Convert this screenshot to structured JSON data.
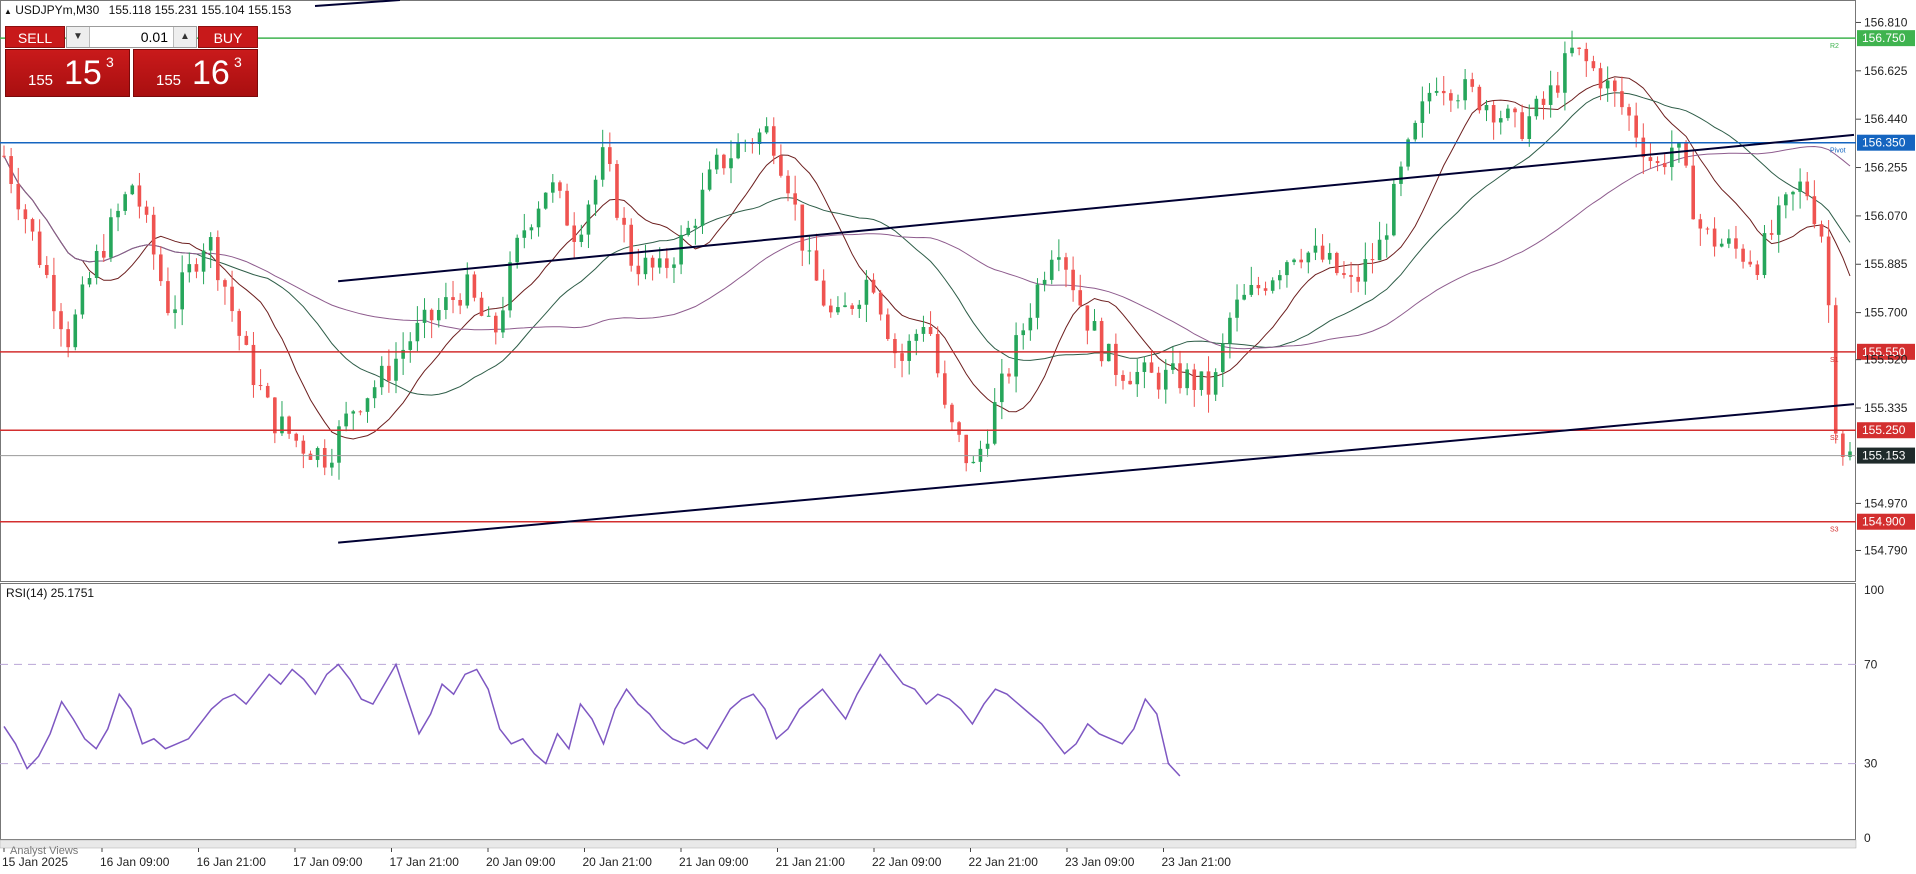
{
  "header": {
    "symbol_timeframe": "USDJPYm,M30",
    "ohlc": "155.118 155.231 155.104 155.153"
  },
  "trade_panel": {
    "sell_label": "SELL",
    "buy_label": "BUY",
    "lot_value": "0.01",
    "bid": {
      "base": "155",
      "big": "15",
      "sup": "3"
    },
    "ask": {
      "base": "155",
      "big": "16",
      "sup": "3"
    }
  },
  "rsi_title": "RSI(14) 25.1751",
  "footer_tab": "Analyst Views",
  "colors": {
    "bull": "#26a65b",
    "bear": "#ef5350",
    "pivot": "#1565c0",
    "resistance": "#3fb34f",
    "support": "#d32f2f",
    "trendline": "#000033",
    "rsi": "#7e57c2",
    "ma_fast": "#6d1f1f",
    "ma_mid": "#2e5d48",
    "ma_slow": "#8e5c8e"
  },
  "chart_data": [
    {
      "type": "candlestick",
      "title": "USDJPYm,M30",
      "ylim": [
        154.7,
        156.85
      ],
      "y_ticks": [
        "156.810",
        "156.625",
        "156.440",
        "156.255",
        "156.070",
        "155.885",
        "155.700",
        "155.520",
        "155.335",
        "154.970",
        "154.790"
      ],
      "x_ticks": [
        "15 Jan 2025",
        "16 Jan 09:00",
        "16 Jan 21:00",
        "17 Jan 09:00",
        "17 Jan 21:00",
        "20 Jan 09:00",
        "20 Jan 21:00",
        "21 Jan 09:00",
        "21 Jan 21:00",
        "22 Jan 09:00",
        "22 Jan 21:00",
        "23 Jan 09:00",
        "23 Jan 21:00"
      ],
      "levels": [
        {
          "name": "R2",
          "value": 156.75,
          "label": "156.750",
          "role": "resistance"
        },
        {
          "name": "Pivot",
          "value": 156.35,
          "label": "156.350",
          "role": "pivot"
        },
        {
          "name": "S1",
          "value": 155.55,
          "label": "155.550",
          "role": "support"
        },
        {
          "name": "S2",
          "value": 155.25,
          "label": "155.250",
          "role": "support"
        },
        {
          "name": "S3",
          "value": 154.9,
          "label": "154.900",
          "role": "support"
        }
      ],
      "current_price": {
        "value": 155.153,
        "label": "155.153"
      },
      "close_path": [
        [
          0,
          156.3
        ],
        [
          0.02,
          155.9
        ],
        [
          0.035,
          155.6
        ],
        [
          0.05,
          155.9
        ],
        [
          0.07,
          156.2
        ],
        [
          0.09,
          155.7
        ],
        [
          0.11,
          156.0
        ],
        [
          0.12,
          155.8
        ],
        [
          0.13,
          155.55
        ],
        [
          0.145,
          155.3
        ],
        [
          0.16,
          155.2
        ],
        [
          0.175,
          155.15
        ],
        [
          0.19,
          155.35
        ],
        [
          0.205,
          155.45
        ],
        [
          0.22,
          155.6
        ],
        [
          0.235,
          155.7
        ],
        [
          0.25,
          155.8
        ],
        [
          0.265,
          155.6
        ],
        [
          0.28,
          156.0
        ],
        [
          0.295,
          156.2
        ],
        [
          0.31,
          156.0
        ],
        [
          0.325,
          156.3
        ],
        [
          0.34,
          155.9
        ],
        [
          0.355,
          155.85
        ],
        [
          0.37,
          156.0
        ],
        [
          0.385,
          156.25
        ],
        [
          0.4,
          156.35
        ],
        [
          0.415,
          156.4
        ],
        [
          0.425,
          156.2
        ],
        [
          0.435,
          155.9
        ],
        [
          0.45,
          155.65
        ],
        [
          0.47,
          155.85
        ],
        [
          0.485,
          155.5
        ],
        [
          0.5,
          155.7
        ],
        [
          0.51,
          155.3
        ],
        [
          0.525,
          155.1
        ],
        [
          0.54,
          155.4
        ],
        [
          0.555,
          155.7
        ],
        [
          0.57,
          156.0
        ],
        [
          0.585,
          155.7
        ],
        [
          0.6,
          155.5
        ],
        [
          0.62,
          155.45
        ],
        [
          0.64,
          155.45
        ],
        [
          0.655,
          155.4
        ],
        [
          0.665,
          155.7
        ],
        [
          0.68,
          155.8
        ],
        [
          0.7,
          155.95
        ],
        [
          0.715,
          155.9
        ],
        [
          0.73,
          155.8
        ],
        [
          0.745,
          155.95
        ],
        [
          0.76,
          156.3
        ],
        [
          0.775,
          156.6
        ],
        [
          0.79,
          156.55
        ],
        [
          0.805,
          156.5
        ],
        [
          0.82,
          156.4
        ],
        [
          0.835,
          156.5
        ],
        [
          0.85,
          156.7
        ],
        [
          0.865,
          156.6
        ],
        [
          0.88,
          156.45
        ],
        [
          0.895,
          156.25
        ],
        [
          0.905,
          156.35
        ],
        [
          0.92,
          156.0
        ],
        [
          0.935,
          155.95
        ],
        [
          0.95,
          155.9
        ],
        [
          0.965,
          156.1
        ],
        [
          0.975,
          156.2
        ],
        [
          0.985,
          156.0
        ],
        [
          0.99,
          155.6
        ],
        [
          0.993,
          155.2
        ],
        [
          1.0,
          155.15
        ]
      ],
      "trendlines": [
        {
          "from": [
            0.181,
            155.82
          ],
          "to": [
            1.0,
            156.38
          ]
        },
        {
          "from": [
            0.181,
            154.82
          ],
          "to": [
            1.0,
            155.35
          ]
        }
      ]
    },
    {
      "type": "line",
      "title": "RSI(14) 25.1751",
      "ylim": [
        0,
        100
      ],
      "y_ticks": [
        "100",
        "70",
        "30",
        "0"
      ],
      "levels": [
        70,
        30
      ],
      "series": [
        {
          "values": [
            45,
            38,
            28,
            33,
            42,
            55,
            48,
            40,
            36,
            44,
            58,
            52,
            38,
            40,
            36,
            38,
            40,
            46,
            52,
            56,
            58,
            54,
            60,
            66,
            62,
            68,
            64,
            58,
            66,
            70,
            64,
            56,
            54,
            62,
            70,
            56,
            42,
            50,
            62,
            58,
            66,
            68,
            60,
            44,
            38,
            40,
            34,
            30,
            42,
            36,
            54,
            48,
            38,
            52,
            60,
            54,
            50,
            44,
            40,
            38,
            40,
            36,
            44,
            52,
            56,
            58,
            52,
            40,
            44,
            52,
            56,
            60,
            54,
            48,
            58,
            66,
            74,
            68,
            62,
            60,
            54,
            58,
            56,
            52,
            46,
            54,
            60,
            58,
            54,
            50,
            46,
            40,
            34,
            38,
            46,
            42,
            40,
            38,
            44,
            56,
            50,
            30,
            25
          ]
        }
      ]
    }
  ]
}
